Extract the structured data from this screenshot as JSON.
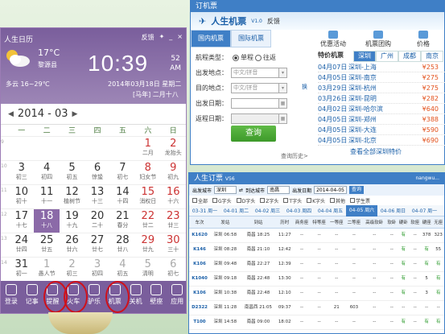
{
  "calendar": {
    "title": "人生日历",
    "controls": [
      "反馈",
      "✦",
      "_",
      "×"
    ],
    "temp": "17°C",
    "place": "黎源县",
    "weather_range": "多云 16~29℃",
    "clock": "10:39",
    "seconds": "52",
    "ampm": "AM",
    "date_line": "2014年03月18日 星期二",
    "lunar_line": "[马年] 二月十八",
    "month_label": "2014 - 03",
    "weekdays": [
      "一",
      "二",
      "三",
      "四",
      "五",
      "六",
      "日"
    ],
    "rows": [
      {
        "wk": "9",
        "cells": [
          {
            "d": "",
            "l": ""
          },
          {
            "d": "",
            "l": ""
          },
          {
            "d": "",
            "l": ""
          },
          {
            "d": "",
            "l": ""
          },
          {
            "d": "",
            "l": ""
          },
          {
            "d": "1",
            "l": "二月"
          },
          {
            "d": "2",
            "l": "龙抬头"
          }
        ]
      },
      {
        "wk": "10",
        "cells": [
          {
            "d": "3",
            "l": "初三"
          },
          {
            "d": "4",
            "l": "初四"
          },
          {
            "d": "5",
            "l": "初五"
          },
          {
            "d": "6",
            "l": "惊蛰"
          },
          {
            "d": "7",
            "l": "初七"
          },
          {
            "d": "8",
            "l": "妇女节"
          },
          {
            "d": "9",
            "l": "初九"
          }
        ]
      },
      {
        "wk": "11",
        "cells": [
          {
            "d": "10",
            "l": "初十"
          },
          {
            "d": "11",
            "l": "十一"
          },
          {
            "d": "12",
            "l": "植树节"
          },
          {
            "d": "13",
            "l": "十三"
          },
          {
            "d": "14",
            "l": "十四"
          },
          {
            "d": "15",
            "l": "消权日"
          },
          {
            "d": "16",
            "l": "十六"
          }
        ]
      },
      {
        "wk": "12",
        "cells": [
          {
            "d": "17",
            "l": "十七"
          },
          {
            "d": "18",
            "l": "十八"
          },
          {
            "d": "19",
            "l": "十九"
          },
          {
            "d": "20",
            "l": "二十"
          },
          {
            "d": "21",
            "l": "春分"
          },
          {
            "d": "22",
            "l": "廿二"
          },
          {
            "d": "23",
            "l": "廿三"
          }
        ]
      },
      {
        "wk": "13",
        "cells": [
          {
            "d": "24",
            "l": "廿四"
          },
          {
            "d": "25",
            "l": "廿五"
          },
          {
            "d": "26",
            "l": "廿六"
          },
          {
            "d": "27",
            "l": "廿七"
          },
          {
            "d": "28",
            "l": "廿八"
          },
          {
            "d": "29",
            "l": "廿九"
          },
          {
            "d": "30",
            "l": "三十"
          }
        ]
      },
      {
        "wk": "14",
        "cells": [
          {
            "d": "31",
            "l": "初一"
          },
          {
            "d": "1",
            "l": "愚人节"
          },
          {
            "d": "2",
            "l": "初三"
          },
          {
            "d": "3",
            "l": "初四"
          },
          {
            "d": "4",
            "l": "初五"
          },
          {
            "d": "5",
            "l": "清明"
          },
          {
            "d": "6",
            "l": "初七"
          }
        ]
      }
    ],
    "toolbar": [
      "登录",
      "记事",
      "提醒",
      "火车",
      "驴乐",
      "机票",
      "关机",
      "壁座",
      "应用"
    ]
  },
  "flight": {
    "window_title": "订机票",
    "brand": "人生机票",
    "version": "V1.0",
    "feedback": "反馈",
    "tabs": [
      "国内机票",
      "国际机票"
    ],
    "right_tabs": [
      "优惠活动",
      "机票团购",
      "价格"
    ],
    "form": {
      "trip_type_label": "航程类型：",
      "one_way": "单程",
      "round_trip": "往返",
      "from_label": "出发地点：",
      "from_placeholder": "中文/拼音",
      "to_label": "目的地点：",
      "to_placeholder": "中文/拼音",
      "swap": "换",
      "depart_label": "出发日期：",
      "return_label": "返程日期：",
      "submit": "查询",
      "history": "查询历史>"
    },
    "deals_title": "特价机票",
    "cities": [
      "深圳",
      "广州",
      "成都",
      "南京"
    ],
    "deals": [
      {
        "date": "04月07日",
        "route": "深圳-上海",
        "price": "¥253"
      },
      {
        "date": "04月05日",
        "route": "深圳-南京",
        "price": "¥275"
      },
      {
        "date": "03月29日",
        "route": "深圳-杭州",
        "price": "¥275"
      },
      {
        "date": "03月26日",
        "route": "深圳-昆明",
        "price": "¥282"
      },
      {
        "date": "04月02日",
        "route": "深圳-哈尔滨",
        "price": "¥640"
      },
      {
        "date": "04月05日",
        "route": "深圳-郑州",
        "price": "¥388"
      },
      {
        "date": "04月05日",
        "route": "深圳-大连",
        "price": "¥590"
      },
      {
        "date": "04月05日",
        "route": "深圳-北京",
        "price": "¥690"
      }
    ],
    "more": "查看全部深圳特价"
  },
  "train": {
    "window_title": "人生订票",
    "version": "V56",
    "user": "nangwu...",
    "from_label": "出发城市",
    "from": "深圳",
    "to_label": "到达城市",
    "to": "南昌",
    "date_label": "出发日期",
    "date": "2014-04-05",
    "search": "查询",
    "types": [
      "全部",
      "G字头",
      "D字头",
      "Z字头",
      "T字头",
      "K字头",
      "其他",
      "学生票"
    ],
    "dates": [
      "03-31 周一",
      "04-01 周二",
      "04-02 周三",
      "04-03 周四",
      "04-04 周五",
      "04-05 周六",
      "04-06 周日",
      "04-07 周一"
    ],
    "headers": [
      "车次",
      "发站",
      "到站",
      "历时",
      "商务座",
      "特等座",
      "一等座",
      "二等座",
      "高级软卧",
      "软卧",
      "硬卧",
      "软座",
      "硬座",
      "无座"
    ],
    "rows": [
      [
        "K1620",
        "深圳 06:58",
        "南昌 18:25",
        "11:27",
        "--",
        "--",
        "--",
        "--",
        "--",
        "--",
        "有",
        "--",
        "378",
        "323"
      ],
      [
        "K146",
        "深圳 08:28",
        "南昌 21:10",
        "12:42",
        "--",
        "--",
        "--",
        "--",
        "--",
        "--",
        "有",
        "--",
        "有",
        "55"
      ],
      [
        "K106",
        "深圳 09:48",
        "南昌 22:27",
        "12:39",
        "--",
        "--",
        "--",
        "--",
        "--",
        "--",
        "有",
        "--",
        "有",
        "有"
      ],
      [
        "K1040",
        "深圳 09:18",
        "南昌 22:48",
        "13:30",
        "--",
        "--",
        "--",
        "--",
        "--",
        "--",
        "有",
        "--",
        "5",
        "有"
      ],
      [
        "K106",
        "深圳 10:38",
        "南昌 22:48",
        "12:10",
        "--",
        "--",
        "--",
        "--",
        "--",
        "--",
        "有",
        "--",
        "3",
        "有"
      ],
      [
        "D2322",
        "深圳 11:28",
        "南昌西 21:05",
        "09:37",
        "--",
        "--",
        "21",
        "603",
        "--",
        "--",
        "--",
        "--",
        "--",
        "--"
      ],
      [
        "T100",
        "深圳 14:58",
        "南昌 09:00",
        "18:02",
        "--",
        "--",
        "--",
        "--",
        "--",
        "--",
        "有",
        "--",
        "有",
        "有"
      ]
    ],
    "footer": "请..."
  }
}
